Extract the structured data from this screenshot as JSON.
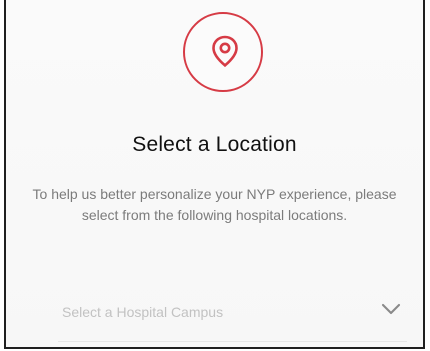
{
  "screen": {
    "title": "Select a Location",
    "description": "To help us better personalize your NYP experience, please select from the following hospital locations.",
    "dropdown": {
      "placeholder": "Select a Hospital Campus",
      "icon": "chevron-down-icon"
    }
  },
  "icons": {
    "location": "location-pin-icon"
  },
  "colors": {
    "accent": "#d63b45",
    "title_text": "#111111",
    "body_text": "#7b7b7b",
    "placeholder_text": "#c2c2c2",
    "background": "#f8f8f8"
  }
}
